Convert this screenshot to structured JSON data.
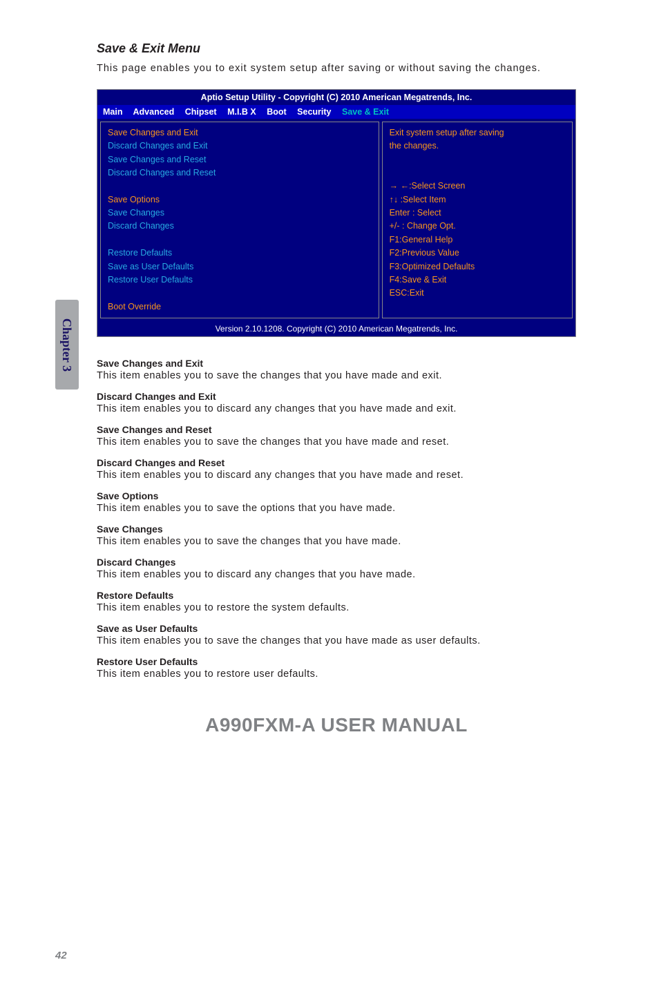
{
  "sidebar_tab": "Chapter 3",
  "section_title": "Save & Exit Menu",
  "intro": "This page enables you to exit system setup after saving or without saving the changes.",
  "bios": {
    "title": "Aptio Setup Utility - Copyright (C) 2010 American Megatrends, Inc.",
    "menus": [
      "Main",
      "Advanced",
      "Chipset",
      "M.I.B X",
      "Boot",
      "Security",
      "Save & Exit"
    ],
    "left": {
      "group1": [
        "Save Changes and Exit",
        "Discard Changes and Exit",
        "Save Changes and Reset",
        "Discard Changes and Reset"
      ],
      "options_hdr": "Save Options",
      "group2": [
        "Save Changes",
        "Discard Changes"
      ],
      "group3": [
        "Restore Defaults",
        "Save as User Defaults",
        "Restore User Defaults"
      ],
      "boot_override": "Boot Override"
    },
    "right": {
      "help1": "Exit system setup after saving",
      "help2": "the changes.",
      "hints": [
        "→ ←:Select Screen",
        "↑↓  :Select Item",
        "Enter : Select",
        "+/-  : Change Opt.",
        "F1:General Help",
        "F2:Previous Value",
        "F3:Optimized Defaults",
        "F4:Save & Exit",
        "ESC:Exit"
      ]
    },
    "footer": "Version 2.10.1208. Copyright (C) 2010  American Megatrends, Inc."
  },
  "items": [
    {
      "title": "Save Changes and Exit",
      "desc": "This item enables you to save the changes that you have made and exit."
    },
    {
      "title": "Discard Changes and Exit",
      "desc": "This item enables you to discard any changes that you have made and exit."
    },
    {
      "title": "Save Changes and Reset",
      "desc": "This item enables you to save the changes that you have made and reset."
    },
    {
      "title": "Discard Changes and Reset",
      "desc": "This item enables you to discard any changes that you have made and reset."
    },
    {
      "title": "Save Options",
      "desc": "This item enables you to save the options that you have made."
    },
    {
      "title": "Save Changes",
      "desc": "This item enables you to save the changes that you have made."
    },
    {
      "title": "Discard Changes",
      "desc": "This item enables you to discard any changes that you have made."
    },
    {
      "title": "Restore Defaults",
      "desc": "This item enables you to restore the system defaults."
    },
    {
      "title": "Save as User Defaults",
      "desc": "This item enables you to save the changes that you have made as user defaults."
    },
    {
      "title": "Restore User Defaults",
      "desc": "This item enables you to restore user defaults."
    }
  ],
  "manual_footer": "A990FXM-A USER MANUAL",
  "page_num": "42"
}
